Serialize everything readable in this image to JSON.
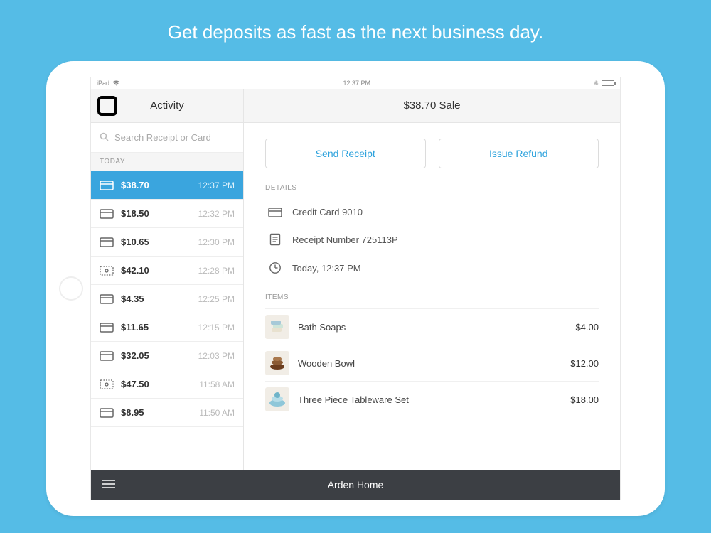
{
  "hero": "Get deposits as fast as the next business day.",
  "status": {
    "device": "iPad",
    "time": "12:37 PM"
  },
  "sidebar": {
    "title": "Activity",
    "search_placeholder": "Search Receipt or Card",
    "section": "Today",
    "transactions": [
      {
        "icon": "card",
        "amount": "$38.70",
        "time": "12:37 PM",
        "selected": true
      },
      {
        "icon": "card",
        "amount": "$18.50",
        "time": "12:32 PM",
        "selected": false
      },
      {
        "icon": "card",
        "amount": "$10.65",
        "time": "12:30 PM",
        "selected": false
      },
      {
        "icon": "cash",
        "amount": "$42.10",
        "time": "12:28 PM",
        "selected": false
      },
      {
        "icon": "card",
        "amount": "$4.35",
        "time": "12:25 PM",
        "selected": false
      },
      {
        "icon": "card",
        "amount": "$11.65",
        "time": "12:15 PM",
        "selected": false
      },
      {
        "icon": "card",
        "amount": "$32.05",
        "time": "12:03 PM",
        "selected": false
      },
      {
        "icon": "cash",
        "amount": "$47.50",
        "time": "11:58 AM",
        "selected": false
      },
      {
        "icon": "card",
        "amount": "$8.95",
        "time": "11:50 AM",
        "selected": false
      }
    ]
  },
  "content": {
    "title": "$38.70 Sale",
    "actions": {
      "send": "Send Receipt",
      "refund": "Issue Refund"
    },
    "details": {
      "label": "Details",
      "rows": [
        {
          "icon": "card",
          "text": "Credit Card 9010"
        },
        {
          "icon": "receipt",
          "text": "Receipt Number 725113P"
        },
        {
          "icon": "clock",
          "text": "Today, 12:37 PM"
        }
      ]
    },
    "items": {
      "label": "Items",
      "rows": [
        {
          "thumb": "soaps",
          "name": "Bath Soaps",
          "price": "$4.00"
        },
        {
          "thumb": "bowls",
          "name": "Wooden Bowl",
          "price": "$12.00"
        },
        {
          "thumb": "plates",
          "name": "Three Piece Tableware Set",
          "price": "$18.00"
        }
      ]
    }
  },
  "footer": {
    "store": "Arden Home"
  }
}
